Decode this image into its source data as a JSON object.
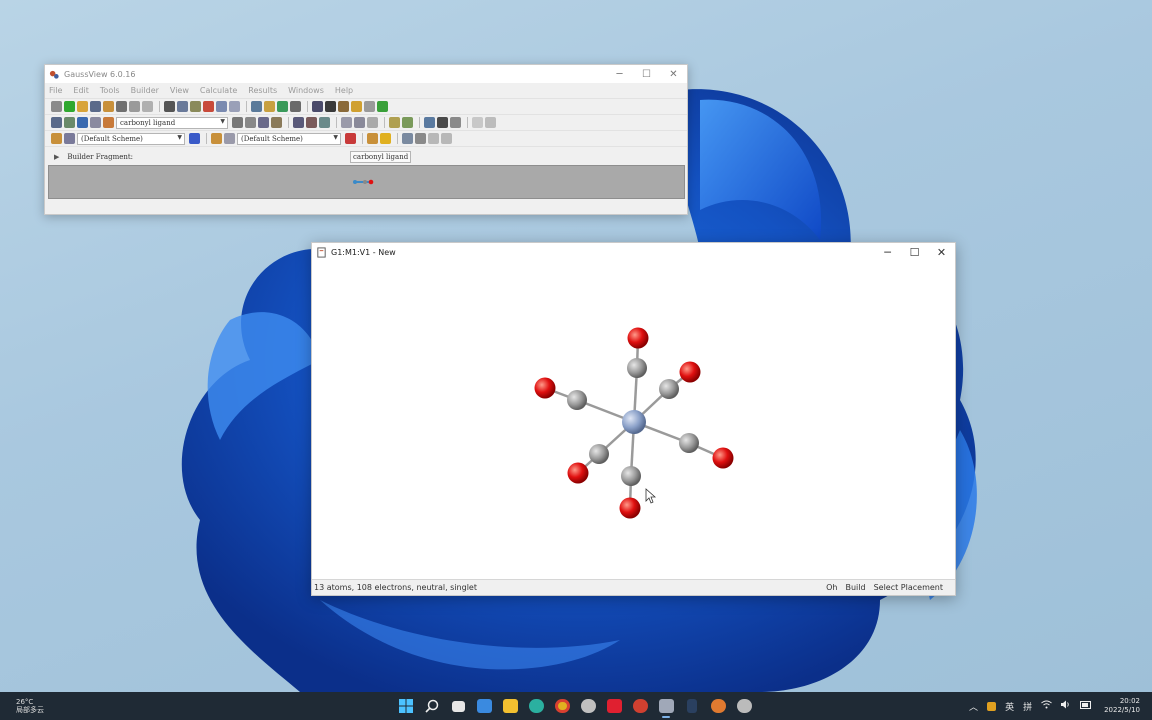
{
  "main_window": {
    "title": "GaussView 6.0.16",
    "menu": [
      "File",
      "Edit",
      "Tools",
      "Builder",
      "View",
      "Calculate",
      "Results",
      "Windows",
      "Help"
    ],
    "fragment_combo": "carbonyl ligand",
    "scheme_combo_1": "(Default Scheme)",
    "scheme_combo_2": "(Default Scheme)",
    "builder_label": "Builder Fragment:",
    "builder_fragment": "carbonyl ligand"
  },
  "view_window": {
    "title": "G1:M1:V1 - New",
    "status_left": "13 atoms, 108 electrons, neutral, singlet",
    "point_group": "Oh",
    "mode": "Build",
    "action": "Select Placement"
  },
  "molecule": {
    "atoms_center": "metal",
    "colors": {
      "metal": "#8aa0c8",
      "carbon": "#9a9a9a",
      "oxygen": "#e01010"
    }
  },
  "taskbar": {
    "weather_temp": "26°C",
    "weather_desc": "局部多云",
    "ime_1": "英",
    "ime_2": "拼",
    "time": "20:02",
    "date": "2022/5/10"
  },
  "icons": {
    "window_minimize": "─",
    "window_maximize": "☐",
    "window_close": "✕"
  }
}
